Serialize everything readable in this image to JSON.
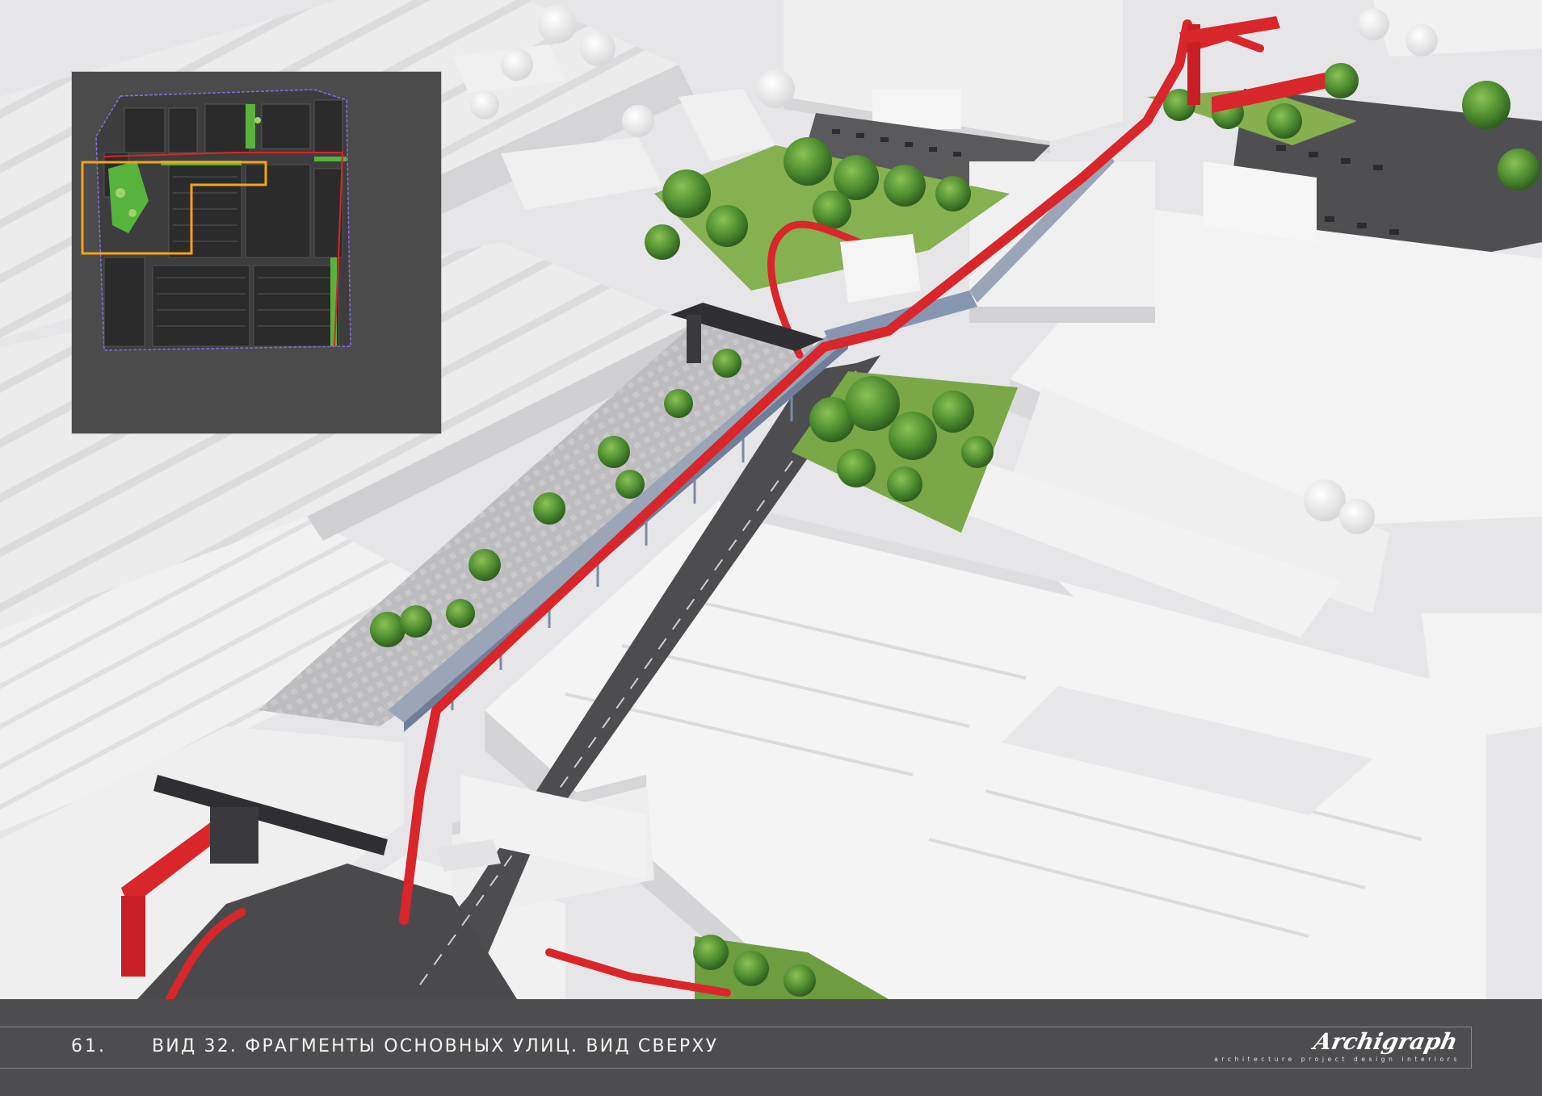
{
  "footer": {
    "page_number": "61.",
    "caption": "ВИД 32. ФРАГМЕНТЫ ОСНОВНЫХ УЛИЦ. ВИД СВЕРХУ"
  },
  "logo": {
    "name": "Archigraph",
    "tagline": "architecture project design interiors"
  },
  "colors": {
    "bridge_red": "#d8262a",
    "greenery": "#5f9e3a",
    "building_white": "#f2f2f3",
    "pavement": "#b9b9bb",
    "road": "#4a4a4c",
    "footer_bg": "#4d4d4f",
    "inset_bg": "#4b4b4c",
    "inset_highlight": "#f5a31a"
  }
}
